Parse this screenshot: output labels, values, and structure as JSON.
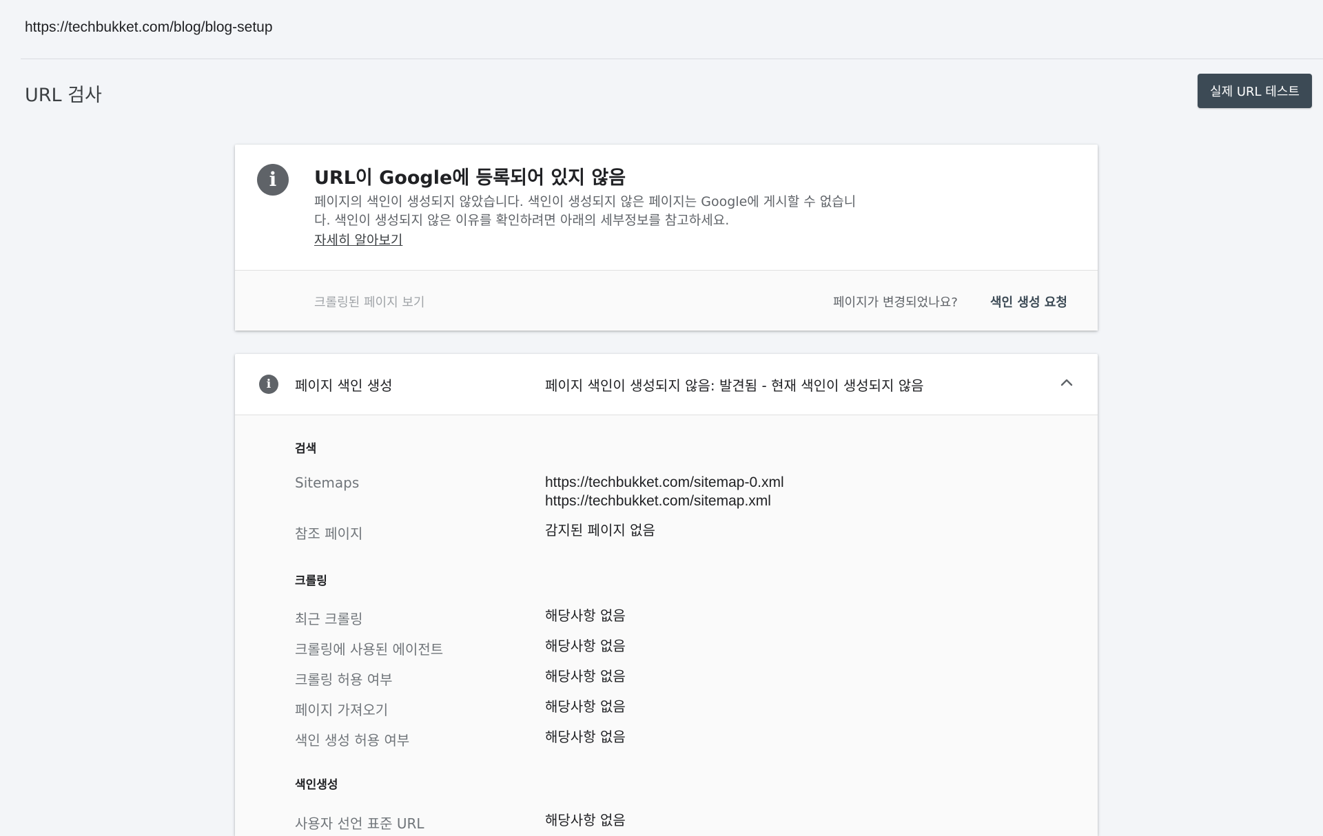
{
  "url_bar": {
    "url": "https://techbukket.com/blog/blog-setup"
  },
  "header": {
    "title": "URL 검사",
    "test_button": "실제 URL 테스트"
  },
  "status": {
    "icon": "info-icon",
    "title": "URL이 Google에 등록되어 있지 않음",
    "description": "페이지의 색인이 생성되지 않았습니다. 색인이 생성되지 않은 페이지는 Google에 게시할 수 없습니다. 색인이 생성되지 않은 이유를 확인하려면 아래의 세부정보를 참고하세요.",
    "learn_more": "자세히 알아보기",
    "view_crawled": "크롤링된 페이지 보기",
    "changed_question": "페이지가 변경되었나요?",
    "request_indexing": "색인 생성 요청"
  },
  "detail": {
    "icon": "info-icon",
    "label": "페이지 색인 생성",
    "summary": "페이지 색인이 생성되지 않음: 발견됨 - 현재 색인이 생성되지 않음",
    "expanded": true,
    "sections": {
      "search": {
        "title": "검색",
        "sitemaps_label": "Sitemaps",
        "sitemaps": [
          "https://techbukket.com/sitemap-0.xml",
          "https://techbukket.com/sitemap.xml"
        ],
        "referring_label": "참조 페이지",
        "referring_value": "감지된 페이지 없음"
      },
      "crawl": {
        "title": "크롤링",
        "rows": [
          {
            "label": "최근 크롤링",
            "value": "해당사항 없음"
          },
          {
            "label": "크롤링에 사용된 에이전트",
            "value": "해당사항 없음"
          },
          {
            "label": "크롤링 허용 여부",
            "value": "해당사항 없음"
          },
          {
            "label": "페이지 가져오기",
            "value": "해당사항 없음"
          },
          {
            "label": "색인 생성 허용 여부",
            "value": "해당사항 없음"
          }
        ]
      },
      "indexing": {
        "title": "색인생성",
        "rows": [
          {
            "label": "사용자 선언 표준 URL",
            "value": "해당사항 없음"
          }
        ]
      }
    }
  }
}
